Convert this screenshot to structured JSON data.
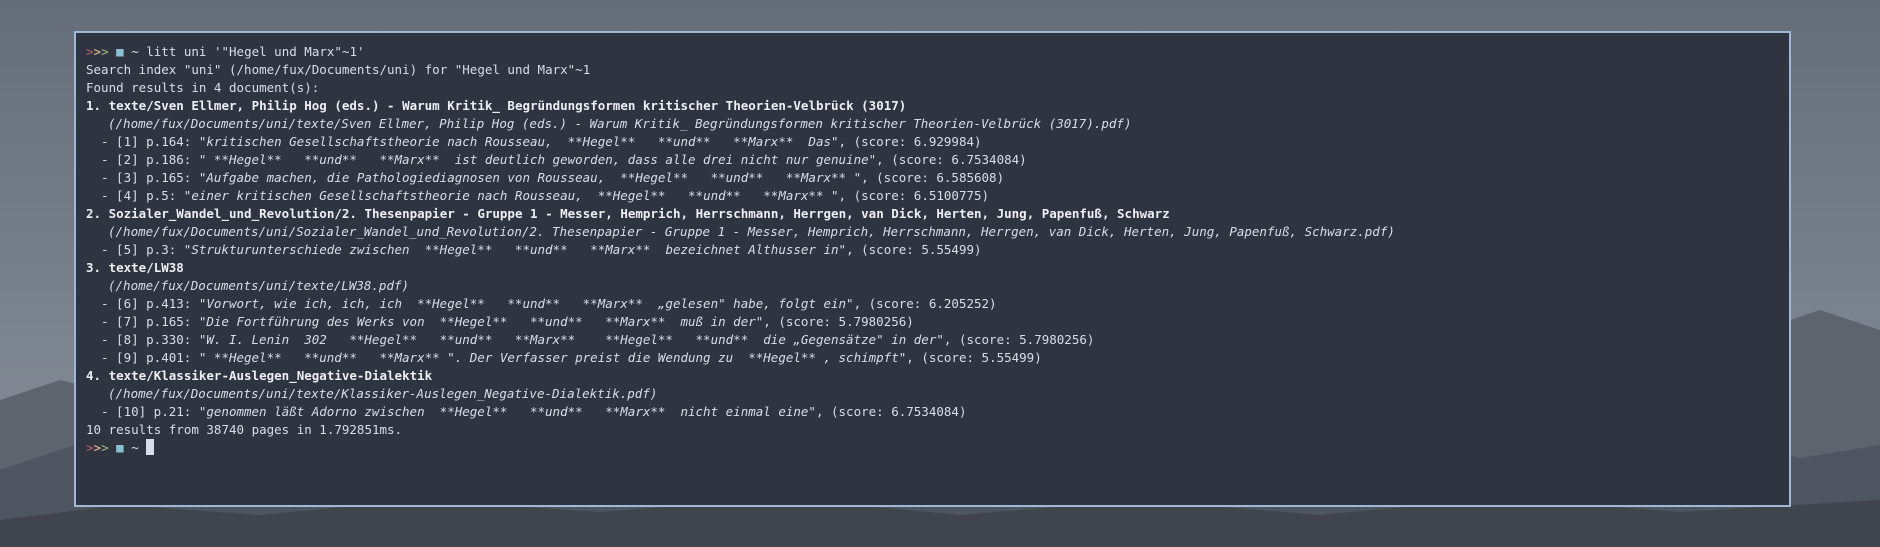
{
  "prompt": {
    "chevrons": ">>>",
    "dir": "~",
    "folder_icon": "folder-icon",
    "colors": {
      "chev1": "#bf616a",
      "chev2": "#ebcb8b",
      "chev3": "#a3be8c",
      "folder": "#88c0d0"
    }
  },
  "command": "litt uni '\"Hegel und Marx\"~1'",
  "search_info": "Search index \"uni\" (/home/fux/Documents/uni) for \"Hegel und Marx\"~1",
  "found_info": "Found results in 4 document(s):",
  "documents": [
    {
      "title": "1. texte/Sven Ellmer, Philip Hog (eds.) - Warum Kritik_ Begründungsformen kritischer Theorien-Velbrück (3017)",
      "path": "(/home/fux/Documents/uni/texte/Sven Ellmer, Philip Hog (eds.) - Warum Kritik_ Begründungsformen kritischer Theorien-Velbrück (3017).pdf)",
      "results": [
        {
          "prefix": "- [1] p.164: ",
          "snippet": "\"kritischen Gesellschaftstheorie nach Rousseau,  **Hegel**   **und**   **Marx**  Das\"",
          "score": ", (score: 6.929984)"
        },
        {
          "prefix": "- [2] p.186: ",
          "snippet": "\" **Hegel**   **und**   **Marx**  ist deutlich geworden, dass alle drei nicht nur genuine\"",
          "score": ", (score: 6.7534084)"
        },
        {
          "prefix": "- [3] p.165: ",
          "snippet": "\"Aufgabe machen, die Pathologiediagnosen von Rousseau,  **Hegel**   **und**   **Marx** \"",
          "score": ", (score: 6.585608)"
        },
        {
          "prefix": "- [4] p.5: ",
          "snippet": "\"einer kritischen Gesellschaftstheorie nach Rousseau,  **Hegel**   **und**   **Marx** \"",
          "score": ", (score: 6.5100775)"
        }
      ]
    },
    {
      "title": "2. Sozialer_Wandel_und_Revolution/2. Thesenpapier - Gruppe 1 - Messer, Hemprich, Herrschmann, Herrgen, van Dick, Herten, Jung, Papenfuß, Schwarz",
      "path": "(/home/fux/Documents/uni/Sozialer_Wandel_und_Revolution/2. Thesenpapier - Gruppe 1 - Messer, Hemprich, Herrschmann, Herrgen, van Dick, Herten, Jung, Papenfuß, Schwarz.pdf)",
      "results": [
        {
          "prefix": "- [5] p.3: ",
          "snippet": "\"Strukturunterschiede zwischen  **Hegel**   **und**   **Marx**  bezeichnet Althusser in\"",
          "score": ", (score: 5.55499)"
        }
      ]
    },
    {
      "title": "3. texte/LW38",
      "path": "(/home/fux/Documents/uni/texte/LW38.pdf)",
      "results": [
        {
          "prefix": "- [6] p.413: ",
          "snippet": "\"Vorwort, wie ich, ich, ich  **Hegel**   **und**   **Marx**  „gelesen\" habe, folgt ein\"",
          "score": ", (score: 6.205252)"
        },
        {
          "prefix": "- [7] p.165: ",
          "snippet": "\"Die Fortführung des Werks von  **Hegel**   **und**   **Marx**  muß in der\"",
          "score": ", (score: 5.7980256)"
        },
        {
          "prefix": "- [8] p.330: ",
          "snippet": "\"W. I. Lenin  302   **Hegel**   **und**   **Marx**    **Hegel**   **und**  die „Gegensätze\" in der\"",
          "score": ", (score: 5.7980256)"
        },
        {
          "prefix": "- [9] p.401: ",
          "snippet": "\" **Hegel**   **und**   **Marx** \". Der Verfasser preist die Wendung zu  **Hegel** , schimpft\"",
          "score": ", (score: 5.55499)"
        }
      ]
    },
    {
      "title": "4. texte/Klassiker-Auslegen_Negative-Dialektik",
      "path": "(/home/fux/Documents/uni/texte/Klassiker-Auslegen_Negative-Dialektik.pdf)",
      "results": [
        {
          "prefix": "- [10] p.21: ",
          "snippet": "\"genommen läßt Adorno zwischen  **Hegel**   **und**   **Marx**  nicht einmal eine\"",
          "score": ", (score: 6.7534084)"
        }
      ]
    }
  ],
  "summary": "10 results from 38740 pages in 1.792851ms."
}
